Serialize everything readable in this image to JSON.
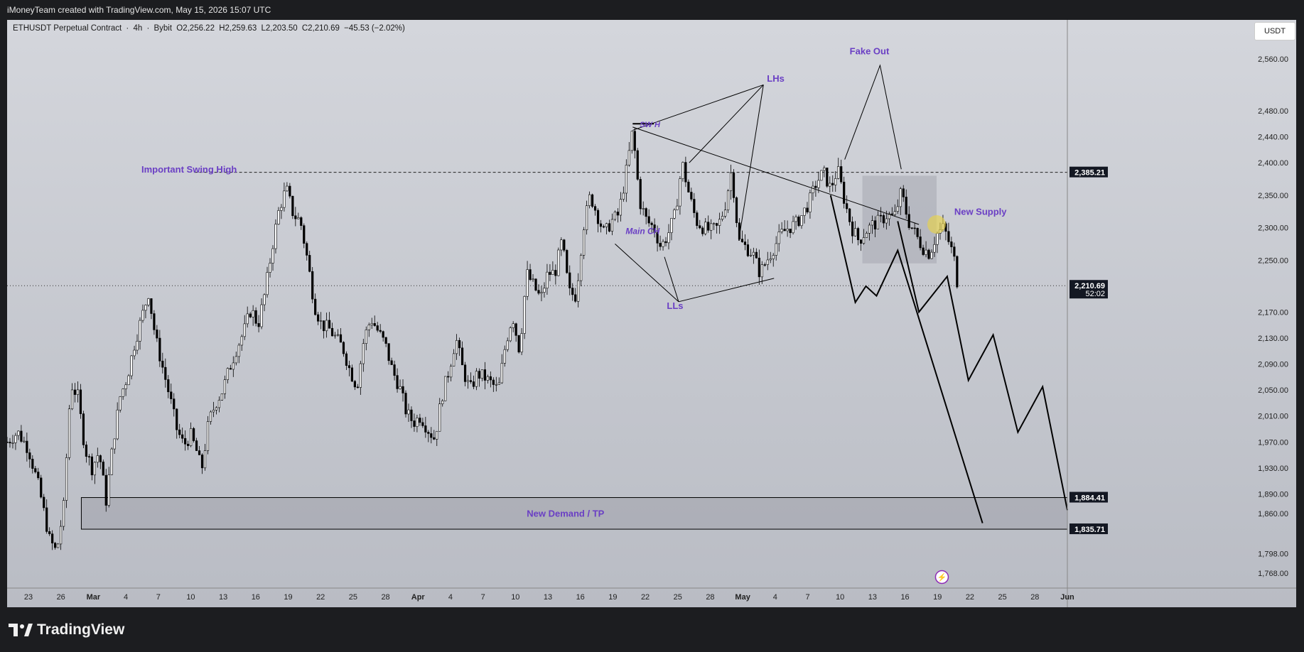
{
  "header": {
    "attribution": "iMoneyTeam created with TradingView.com, May 15, 2026 15:07 UTC"
  },
  "symbol_bar": {
    "name": "ETHUSDT Perpetual Contract",
    "sep1": "·",
    "interval": "4h",
    "sep2": "·",
    "exchange": "Bybit",
    "open": "O2,256.22",
    "high": "H2,259.63",
    "low": "L2,203.50",
    "close": "C2,210.69",
    "change": "−45.53 (−2.02%)"
  },
  "currency_button": "USDT",
  "footer": {
    "brand": "TradingView"
  },
  "colors": {
    "background": "#1c1d20",
    "chart_bg_top": "#d4d6dc",
    "chart_bg_bottom": "#b9bcc4",
    "candle": "#000000",
    "annotation": "#6a3fc4",
    "zone": "#a6a8b0",
    "marker": "#e8d24a"
  },
  "chart_data": {
    "type": "candlestick",
    "title": "ETHUSDT Perpetual Contract · 4h · Bybit",
    "ylim": [
      1745,
      2620
    ],
    "y_axis_ticks": [
      "2,560.00",
      "2,480.00",
      "2,440.00",
      "2,400.00",
      "2,350.00",
      "2,300.00",
      "2,250.00",
      "2,170.00",
      "2,130.00",
      "2,090.00",
      "2,050.00",
      "2,010.00",
      "1,970.00",
      "1,930.00",
      "1,890.00",
      "1,860.00",
      "1,798.00",
      "1,768.00"
    ],
    "y_axis_tick_values": [
      2560,
      2480,
      2440,
      2400,
      2350,
      2300,
      2250,
      2170,
      2130,
      2090,
      2050,
      2010,
      1970,
      1930,
      1890,
      1860,
      1798,
      1768
    ],
    "x_axis_ticks": [
      "23",
      "26",
      "Mar",
      "4",
      "7",
      "10",
      "13",
      "16",
      "19",
      "22",
      "25",
      "28",
      "Apr",
      "4",
      "7",
      "10",
      "13",
      "16",
      "19",
      "22",
      "25",
      "28",
      "May",
      "4",
      "7",
      "10",
      "13",
      "16",
      "19",
      "22",
      "25",
      "28",
      "Jun"
    ],
    "x_axis_bold": [
      "Mar",
      "Apr",
      "May",
      "Jun"
    ],
    "price_labels": [
      {
        "text": "2,385.21",
        "value": 2385.21
      },
      {
        "text": "2,210.69",
        "value": 2210.69,
        "sub": "52:02"
      },
      {
        "text": "1,884.41",
        "value": 1884.41
      },
      {
        "text": "1,835.71",
        "value": 1835.71
      }
    ],
    "levels": {
      "important_swing_high": 2385.21,
      "last_price": 2210.69,
      "demand_top": 1884.41,
      "demand_bottom": 1835.71,
      "supply_top": 2380,
      "supply_bottom": 2245
    },
    "price_path": [
      [
        0,
        1970
      ],
      [
        3,
        1985
      ],
      [
        6,
        1960
      ],
      [
        9,
        1900
      ],
      [
        12,
        1820
      ],
      [
        14,
        1800
      ],
      [
        16,
        1870
      ],
      [
        18,
        2060
      ],
      [
        20,
        2040
      ],
      [
        22,
        1960
      ],
      [
        24,
        1930
      ],
      [
        26,
        1955
      ],
      [
        28,
        1880
      ],
      [
        30,
        1970
      ],
      [
        32,
        2040
      ],
      [
        34,
        2070
      ],
      [
        36,
        2120
      ],
      [
        38,
        2160
      ],
      [
        40,
        2200
      ],
      [
        42,
        2130
      ],
      [
        44,
        2085
      ],
      [
        46,
        2040
      ],
      [
        48,
        1990
      ],
      [
        50,
        1965
      ],
      [
        52,
        1980
      ],
      [
        54,
        1950
      ],
      [
        55,
        1925
      ],
      [
        57,
        2000
      ],
      [
        59,
        2030
      ],
      [
        61,
        2050
      ],
      [
        63,
        2085
      ],
      [
        65,
        2115
      ],
      [
        67,
        2140
      ],
      [
        69,
        2175
      ],
      [
        71,
        2150
      ],
      [
        73,
        2200
      ],
      [
        75,
        2270
      ],
      [
        77,
        2330
      ],
      [
        79,
        2360
      ],
      [
        81,
        2320
      ],
      [
        83,
        2310
      ],
      [
        85,
        2250
      ],
      [
        87,
        2180
      ],
      [
        89,
        2150
      ],
      [
        91,
        2145
      ],
      [
        93,
        2130
      ],
      [
        95,
        2115
      ],
      [
        97,
        2080
      ],
      [
        99,
        2055
      ],
      [
        101,
        2130
      ],
      [
        103,
        2160
      ],
      [
        105,
        2140
      ],
      [
        107,
        2120
      ],
      [
        109,
        2080
      ],
      [
        111,
        2055
      ],
      [
        113,
        2015
      ],
      [
        115,
        2000
      ],
      [
        117,
        2010
      ],
      [
        119,
        1990
      ],
      [
        121,
        1975
      ],
      [
        123,
        2040
      ],
      [
        125,
        2080
      ],
      [
        127,
        2130
      ],
      [
        129,
        2080
      ],
      [
        131,
        2050
      ],
      [
        133,
        2075
      ],
      [
        135,
        2070
      ],
      [
        137,
        2060
      ],
      [
        139,
        2050
      ],
      [
        141,
        2120
      ],
      [
        143,
        2165
      ],
      [
        145,
        2110
      ],
      [
        147,
        2230
      ],
      [
        149,
        2210
      ],
      [
        151,
        2190
      ],
      [
        153,
        2230
      ],
      [
        155,
        2230
      ],
      [
        157,
        2280
      ],
      [
        159,
        2200
      ],
      [
        161,
        2195
      ],
      [
        163,
        2300
      ],
      [
        165,
        2350
      ],
      [
        167,
        2320
      ],
      [
        169,
        2290
      ],
      [
        171,
        2310
      ],
      [
        173,
        2320
      ],
      [
        175,
        2380
      ],
      [
        177,
        2450
      ],
      [
        179,
        2340
      ],
      [
        181,
        2310
      ],
      [
        183,
        2300
      ],
      [
        185,
        2270
      ],
      [
        187,
        2290
      ],
      [
        189,
        2320
      ],
      [
        191,
        2400
      ],
      [
        193,
        2350
      ],
      [
        195,
        2310
      ],
      [
        197,
        2300
      ],
      [
        199,
        2295
      ],
      [
        201,
        2300
      ],
      [
        203,
        2330
      ],
      [
        205,
        2390
      ],
      [
        207,
        2280
      ],
      [
        209,
        2270
      ],
      [
        211,
        2260
      ],
      [
        213,
        2230
      ],
      [
        215,
        2250
      ],
      [
        217,
        2270
      ],
      [
        219,
        2290
      ],
      [
        221,
        2300
      ],
      [
        223,
        2305
      ],
      [
        225,
        2320
      ],
      [
        227,
        2340
      ],
      [
        229,
        2370
      ],
      [
        231,
        2385
      ],
      [
        233,
        2360
      ],
      [
        235,
        2390
      ],
      [
        237,
        2340
      ],
      [
        239,
        2300
      ],
      [
        241,
        2280
      ],
      [
        243,
        2295
      ],
      [
        245,
        2305
      ],
      [
        247,
        2310
      ],
      [
        249,
        2320
      ],
      [
        251,
        2315
      ],
      [
        253,
        2355
      ],
      [
        255,
        2310
      ],
      [
        257,
        2290
      ],
      [
        259,
        2270
      ],
      [
        261,
        2260
      ],
      [
        263,
        2290
      ],
      [
        265,
        2300
      ],
      [
        267,
        2270
      ],
      [
        268,
        2250
      ],
      [
        269,
        2210
      ]
    ],
    "annotations": [
      {
        "text": "Important Swing High"
      },
      {
        "text": "SW H"
      },
      {
        "text": "LHs"
      },
      {
        "text": "Fake Out"
      },
      {
        "text": "Main CH"
      },
      {
        "text": "LLs"
      },
      {
        "text": "New Supply"
      },
      {
        "text": "New Demand / TP"
      }
    ],
    "projection_paths": [
      [
        [
          233,
          2350
        ],
        [
          240,
          2185
        ],
        [
          243,
          2210
        ],
        [
          246,
          2195
        ],
        [
          252,
          2265
        ],
        [
          276,
          1845
        ]
      ],
      [
        [
          252,
          2310
        ],
        [
          258,
          2170
        ],
        [
          266,
          2225
        ],
        [
          272,
          2065
        ],
        [
          279,
          2135
        ],
        [
          286,
          1985
        ],
        [
          293,
          2055
        ],
        [
          300,
          1865
        ]
      ]
    ],
    "x_range": [
      0,
      300
    ]
  }
}
